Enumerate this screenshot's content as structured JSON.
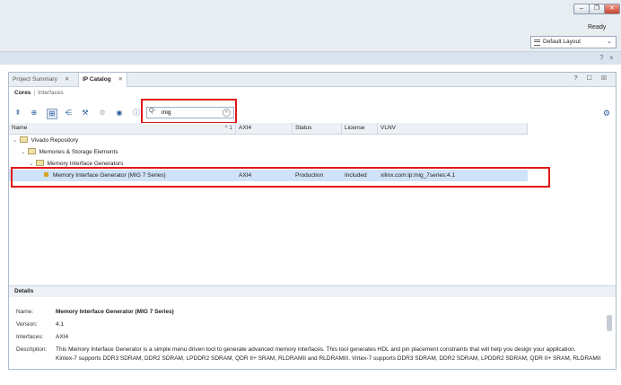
{
  "window": {
    "status": "Ready",
    "layout_select": "Default Layout",
    "help_icons": [
      "?",
      "×"
    ]
  },
  "tabs": [
    {
      "label": "Project Summary"
    },
    {
      "label": "IP Catalog"
    }
  ],
  "panel_icons": "? ☐ ☒",
  "subtabs": {
    "active": "Cores",
    "other": "Interfaces"
  },
  "search": {
    "value": "mig",
    "placeholder": ""
  },
  "table": {
    "columns": [
      "Name",
      "AXI4",
      "Status",
      "License",
      "VLNV"
    ],
    "sort_indicator": "^ 1",
    "tree": [
      {
        "label": "Vivado Repository"
      },
      {
        "label": "Memories & Storage Elements"
      },
      {
        "label": "Memory Interface Generators"
      }
    ],
    "selected_row": {
      "name": "Memory Interface Generator (MIG 7 Series)",
      "axi4": "AXI4",
      "status": "Production",
      "license": "Included",
      "vlnv": "xilinx.com:ip:mig_7series:4.1"
    }
  },
  "details": {
    "title": "Details",
    "name_label": "Name:",
    "name_value": "Memory Interface Generator (MIG 7 Series)",
    "version_label": "Version:",
    "version_value": "4.1",
    "interfaces_label": "Interfaces:",
    "interfaces_value": "AXI4",
    "description_label": "Description:",
    "description_line1": "This Memory Interface Generator is a simple menu driven tool to generate advanced memory interfaces.  This tool generates HDL and pin placement constraints that will help you design your application.",
    "description_line2": "Kintex-7 supports DDR3 SDRAM, DDR2 SDRAM, LPDDR2 SDRAM, QDR II+ SRAM, RLDRAMII and RLDRAMIII. Virtex-7 supports DDR3 SDRAM, DDR2 SDRAM, LPDDR2 SDRAM, QDR II+ SRAM, RLDRAMII"
  },
  "colors": {
    "highlight": "#e01818",
    "selection": "#cfe2f7",
    "accent": "#2b5d9a"
  }
}
